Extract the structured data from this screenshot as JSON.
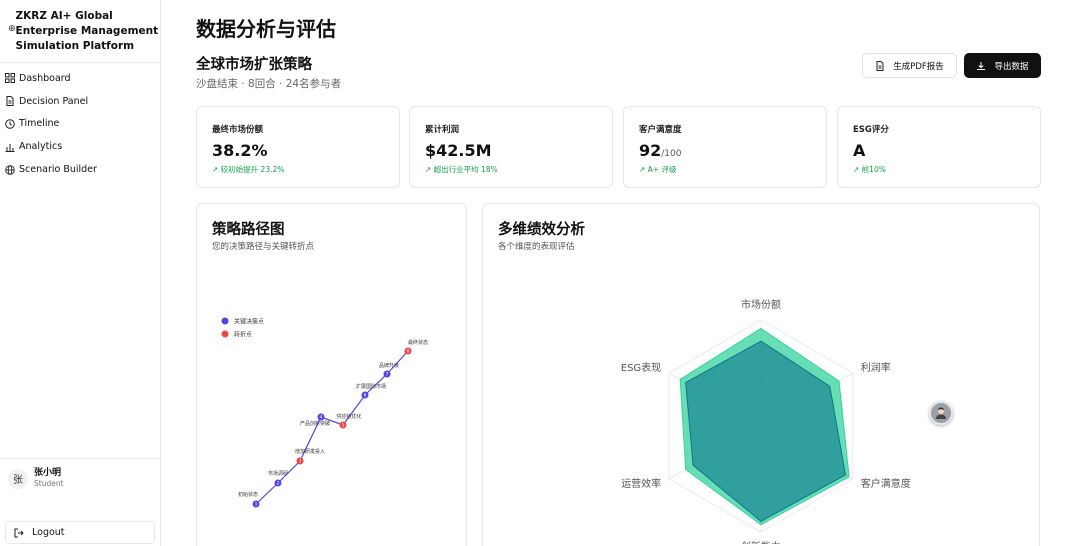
{
  "sidebar": {
    "brand_icon": "⊕",
    "brand_line1": "ZKRZ AI+ Global",
    "brand_line2": "Enterprise Management",
    "brand_line3": "Simulation Platform",
    "items": [
      {
        "label": "Dashboard",
        "icon": "grid-icon"
      },
      {
        "label": "Decision Panel",
        "icon": "file-icon"
      },
      {
        "label": "Timeline",
        "icon": "clock-icon"
      },
      {
        "label": "Analytics",
        "icon": "bar-chart-icon"
      },
      {
        "label": "Scenario Builder",
        "icon": "globe-icon"
      }
    ],
    "user": {
      "avatar": "张",
      "name": "张小明",
      "role": "Student"
    },
    "logout_label": "Logout"
  },
  "header": {
    "title": "数据分析与评估",
    "subtitle": "全球市场扩张策略",
    "meta": "沙盘结束 · 8回合 · 24名参与者",
    "pdf_button": "生成PDF报告",
    "export_button": "导出数据"
  },
  "stats": [
    {
      "label": "最终市场份额",
      "value": "38.2%",
      "suffix": "",
      "note": "↗ 较初始提升 23.2%"
    },
    {
      "label": "累计利润",
      "value": "$42.5M",
      "suffix": "",
      "note": "↗ 超出行业平均 18%"
    },
    {
      "label": "客户满意度",
      "value": "92",
      "suffix": "/100",
      "note": "↗ A+ 评级"
    },
    {
      "label": "ESG评分",
      "value": "A",
      "suffix": "",
      "note": "↗ 前10%"
    }
  ],
  "path_card": {
    "title": "策略路径图",
    "subtitle": "您的决策路径与关键转折点",
    "legend": [
      {
        "label": "关键决策点",
        "color": "#4f46e5"
      },
      {
        "label": "转折点",
        "color": "#ef4444"
      }
    ],
    "chart_data": {
      "type": "line",
      "points": [
        {
          "label": "初始状态",
          "kind": "decision"
        },
        {
          "label": "市场调研",
          "kind": "decision"
        },
        {
          "label": "增加研发投入",
          "kind": "turning"
        },
        {
          "label": "产品创新突破",
          "kind": "decision"
        },
        {
          "label": "供应链优化",
          "kind": "turning"
        },
        {
          "label": "扩展国际市场",
          "kind": "decision"
        },
        {
          "label": "品牌升级",
          "kind": "decision"
        },
        {
          "label": "最终状态",
          "kind": "turning"
        }
      ]
    }
  },
  "radar_card": {
    "title": "多维绩效分析",
    "subtitle": "各个维度的表现评估",
    "chart_data": {
      "type": "radar",
      "axes": [
        "市场份额",
        "利润率",
        "客户满意度",
        "创新能力",
        "运营效率",
        "ESG表现"
      ],
      "max": 100,
      "series": [
        {
          "values": [
            92,
            85,
            96,
            93,
            82,
            88
          ],
          "color": "#34d399"
        },
        {
          "values": [
            80,
            75,
            92,
            90,
            74,
            82
          ],
          "color": "#0e7490"
        }
      ]
    }
  },
  "assistant_icon": "assistant-avatar-icon"
}
